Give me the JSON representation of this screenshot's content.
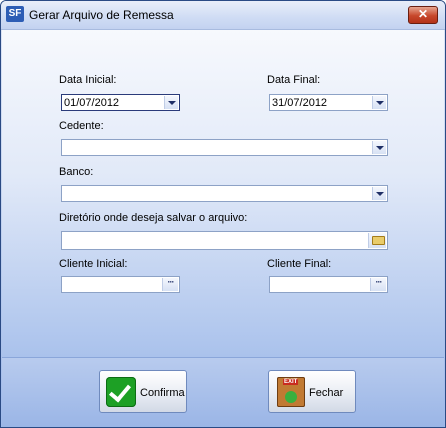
{
  "window": {
    "title": "Gerar Arquivo de Remessa",
    "app_icon": "SF",
    "close_symbol": "✕"
  },
  "form": {
    "data_inicial_label": "Data Inicial:",
    "data_inicial_value": "01/07/2012",
    "data_final_label": "Data Final:",
    "data_final_value": "31/07/2012",
    "cedente_label": "Cedente:",
    "cedente_value": "",
    "banco_label": "Banco:",
    "banco_value": "",
    "diretorio_label": "Diretório onde deseja salvar o arquivo:",
    "diretorio_value": "",
    "cliente_inicial_label": "Cliente Inicial:",
    "cliente_inicial_value": "",
    "cliente_final_label": "Cliente Final:",
    "cliente_final_value": "",
    "lookup_symbol": "···"
  },
  "buttons": {
    "confirma_label": "Confirma",
    "fechar_label": "Fechar"
  },
  "icons": {
    "confirma": "check-icon",
    "fechar": "exit-door-icon",
    "diretorio": "folder-icon"
  }
}
